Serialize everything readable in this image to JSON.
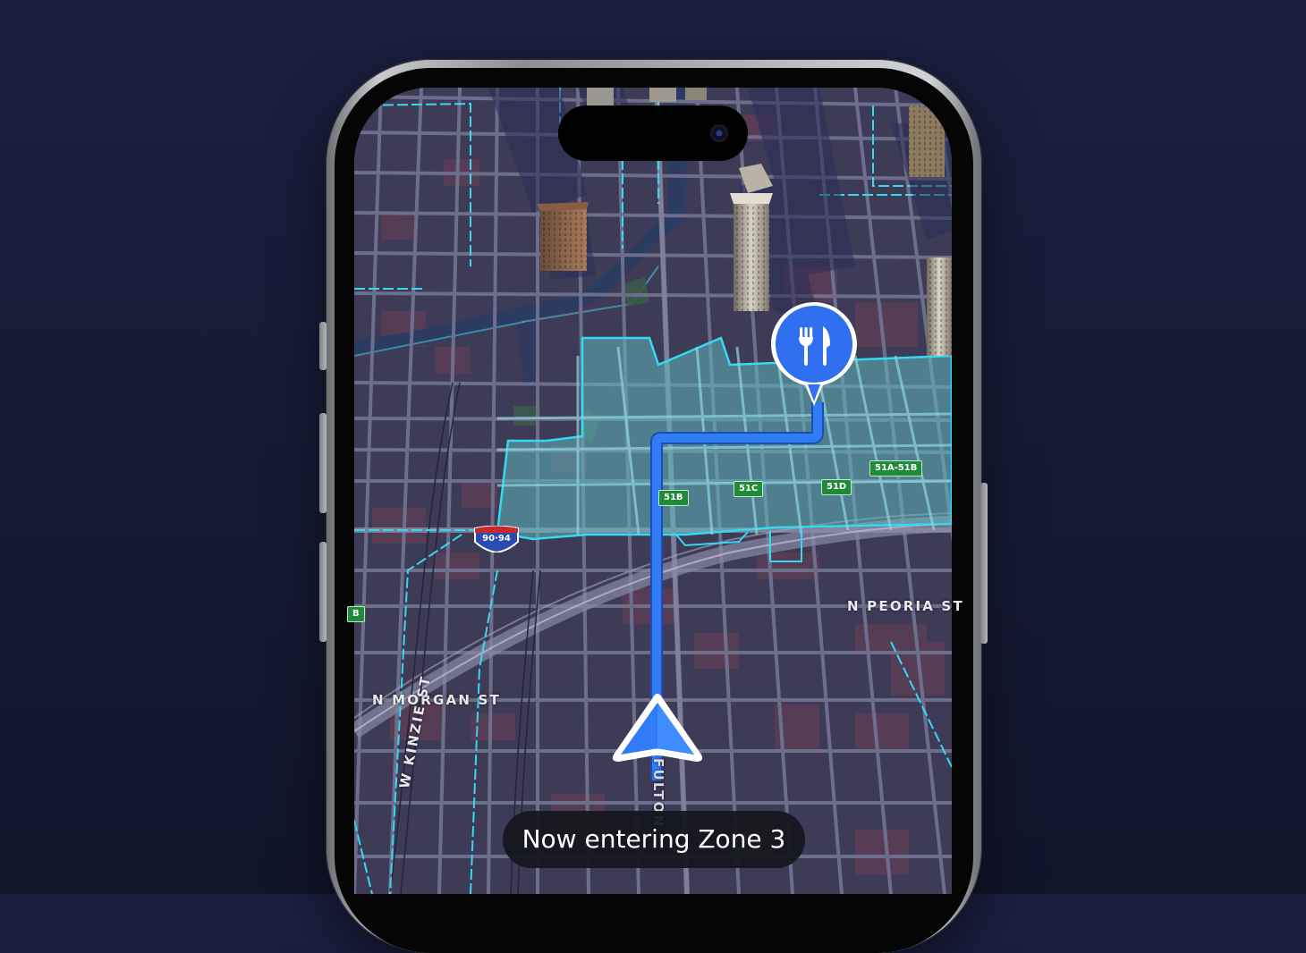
{
  "map": {
    "streets": {
      "peoria": "N PEORIA ST",
      "morgan": "N MORGAN ST",
      "kinzie": "W KINZIE ST",
      "fulton": "FULTON"
    },
    "exits": [
      "51B",
      "51C",
      "51D",
      "51A-51B",
      "B"
    ],
    "interstate_shield": "90·94",
    "destination_icon": "restaurant-fork-knife-icon",
    "user_location_icon": "navigation-arrow-icon",
    "colors": {
      "zone_fill": "#5fb8c0",
      "zone_border": "#35d9f0",
      "route": "#2f7cf6",
      "pin": "#2f6ff0",
      "background": "#1a1f3e"
    }
  },
  "toast": {
    "message": "Now entering Zone 3"
  }
}
